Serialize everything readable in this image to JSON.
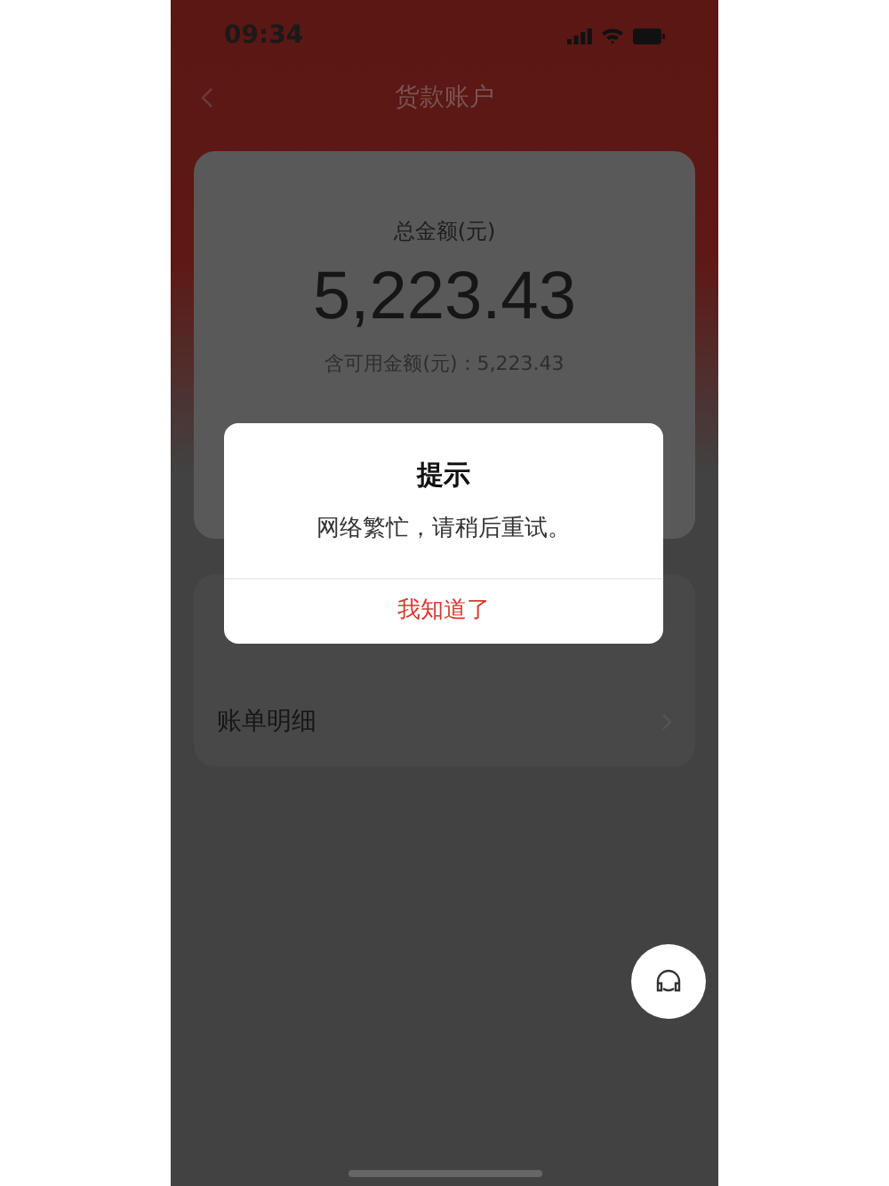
{
  "status_bar": {
    "time": "09:34"
  },
  "header": {
    "title": "货款账户"
  },
  "balance": {
    "label": "总金额(元)",
    "amount": "5,223.43",
    "available": "含可用金额(元)：5,223.43"
  },
  "menu": [
    {
      "label": "账单明细"
    }
  ],
  "dialog": {
    "title": "提示",
    "message": "网络繁忙，请稍后重试。",
    "button": "我知道了"
  }
}
